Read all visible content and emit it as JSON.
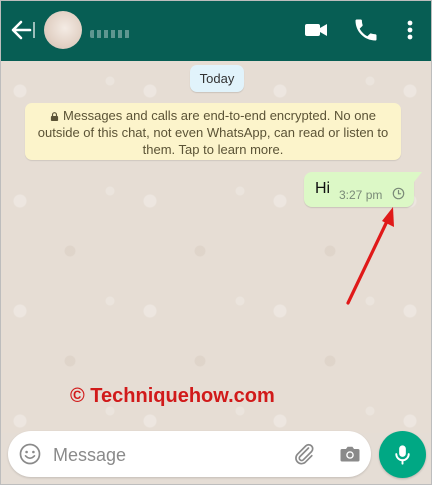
{
  "header": {
    "contact_name": "",
    "icons": [
      "back-arrow-icon",
      "video-call-icon",
      "voice-call-icon",
      "more-options-icon"
    ],
    "background_color": "#075e54"
  },
  "chat": {
    "date_chip": "Today",
    "encryption_notice": "Messages and calls are end-to-end encrypted. No one outside of this chat, not even WhatsApp, can read or listen to them. Tap to learn more.",
    "messages": [
      {
        "text": "Hi",
        "time": "3:27 pm",
        "status": "pending",
        "status_icon": "clock-icon"
      }
    ],
    "watermark": "© Techniquehow.com",
    "bubble_color": "#dcf8c6"
  },
  "input_bar": {
    "placeholder": "Message",
    "value": "",
    "icons": [
      "emoji-icon",
      "attach-icon",
      "camera-icon"
    ],
    "mic_color": "#00a884"
  }
}
